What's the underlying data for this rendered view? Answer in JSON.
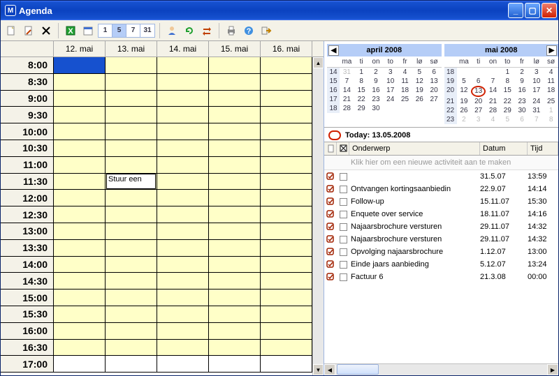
{
  "window": {
    "title": "Agenda"
  },
  "days": [
    "12. mai",
    "13. mai",
    "14. mai",
    "15. mai",
    "16. mai"
  ],
  "times": [
    "8:00",
    "8:30",
    "9:00",
    "9:30",
    "10:00",
    "10:30",
    "11:00",
    "11:30",
    "12:00",
    "12:30",
    "13:00",
    "13:30",
    "14:00",
    "14:30",
    "15:00",
    "15:30",
    "16:00",
    "16:30",
    "17:00"
  ],
  "appointment": {
    "text": "Stuur een",
    "dayIndex": 1,
    "timeIndex": 7
  },
  "calendars": {
    "left": {
      "title": "april 2008",
      "dayhead": [
        "ma",
        "ti",
        "on",
        "to",
        "fr",
        "lø",
        "sø"
      ],
      "weeks": [
        "14",
        "15",
        "16",
        "17",
        "18"
      ],
      "grid": [
        [
          [
            "31",
            true
          ],
          [
            "1",
            false
          ],
          [
            "2",
            false
          ],
          [
            "3",
            false
          ],
          [
            "4",
            false
          ],
          [
            "5",
            false
          ],
          [
            "6",
            false
          ]
        ],
        [
          [
            "7",
            false
          ],
          [
            "8",
            false
          ],
          [
            "9",
            false
          ],
          [
            "10",
            false
          ],
          [
            "11",
            false
          ],
          [
            "12",
            false
          ],
          [
            "13",
            false
          ]
        ],
        [
          [
            "14",
            false
          ],
          [
            "15",
            false
          ],
          [
            "16",
            false
          ],
          [
            "17",
            false
          ],
          [
            "18",
            false
          ],
          [
            "19",
            false
          ],
          [
            "20",
            false
          ]
        ],
        [
          [
            "21",
            false
          ],
          [
            "22",
            false
          ],
          [
            "23",
            false
          ],
          [
            "24",
            false
          ],
          [
            "25",
            false
          ],
          [
            "26",
            false
          ],
          [
            "27",
            false
          ]
        ],
        [
          [
            "28",
            false
          ],
          [
            "29",
            false
          ],
          [
            "30",
            false
          ],
          [
            "",
            false
          ],
          [
            "",
            false
          ],
          [
            "",
            false
          ],
          [
            "",
            false
          ]
        ]
      ]
    },
    "right": {
      "title": "mai 2008",
      "dayhead": [
        "ma",
        "ti",
        "on",
        "to",
        "fr",
        "lø",
        "sø"
      ],
      "weeks": [
        "18",
        "19",
        "20",
        "21",
        "22",
        "23"
      ],
      "grid": [
        [
          [
            "",
            false
          ],
          [
            "",
            false
          ],
          [
            "",
            false
          ],
          [
            "1",
            false
          ],
          [
            "2",
            false
          ],
          [
            "3",
            false
          ],
          [
            "4",
            false
          ]
        ],
        [
          [
            "5",
            false
          ],
          [
            "6",
            false
          ],
          [
            "7",
            false
          ],
          [
            "8",
            false
          ],
          [
            "9",
            false
          ],
          [
            "10",
            false
          ],
          [
            "11",
            false
          ]
        ],
        [
          [
            "12",
            false
          ],
          [
            "13",
            false,
            true
          ],
          [
            "14",
            false
          ],
          [
            "15",
            false
          ],
          [
            "16",
            false
          ],
          [
            "17",
            false
          ],
          [
            "18",
            false
          ]
        ],
        [
          [
            "19",
            false
          ],
          [
            "20",
            false
          ],
          [
            "21",
            false
          ],
          [
            "22",
            false
          ],
          [
            "23",
            false
          ],
          [
            "24",
            false
          ],
          [
            "25",
            false
          ]
        ],
        [
          [
            "26",
            false
          ],
          [
            "27",
            false
          ],
          [
            "28",
            false
          ],
          [
            "29",
            false
          ],
          [
            "30",
            false
          ],
          [
            "31",
            false
          ],
          [
            "1",
            true
          ]
        ],
        [
          [
            "2",
            true
          ],
          [
            "3",
            true
          ],
          [
            "4",
            true
          ],
          [
            "5",
            true
          ],
          [
            "6",
            true
          ],
          [
            "7",
            true
          ],
          [
            "8",
            true
          ]
        ]
      ]
    }
  },
  "today": {
    "label": "Today:",
    "date": "13.05.2008"
  },
  "tasks": {
    "columns": [
      "",
      "",
      "Onderwerp",
      "Datum",
      "Tijd"
    ],
    "placeholder": "Klik hier om een nieuwe activiteit aan te maken",
    "rows": [
      {
        "text": "",
        "date": "31.5.07",
        "time": "13:59"
      },
      {
        "text": "Ontvangen kortingsaanbiedin",
        "date": "22.9.07",
        "time": "14:14"
      },
      {
        "text": "Follow-up",
        "date": "15.11.07",
        "time": "15:30"
      },
      {
        "text": "Enquete over service",
        "date": "18.11.07",
        "time": "14:16"
      },
      {
        "text": "Najaarsbrochure versturen",
        "date": "29.11.07",
        "time": "14:32"
      },
      {
        "text": "Najaarsbrochure versturen",
        "date": "29.11.07",
        "time": "14:32"
      },
      {
        "text": "Opvolging najaarsbrochure",
        "date": "1.12.07",
        "time": "13:00"
      },
      {
        "text": "Einde jaars aanbieding",
        "date": "5.12.07",
        "time": "13:24"
      },
      {
        "text": "Factuur 6",
        "date": "21.3.08",
        "time": "00:00"
      }
    ]
  },
  "range_buttons": [
    "1",
    "5",
    "7",
    "31"
  ]
}
